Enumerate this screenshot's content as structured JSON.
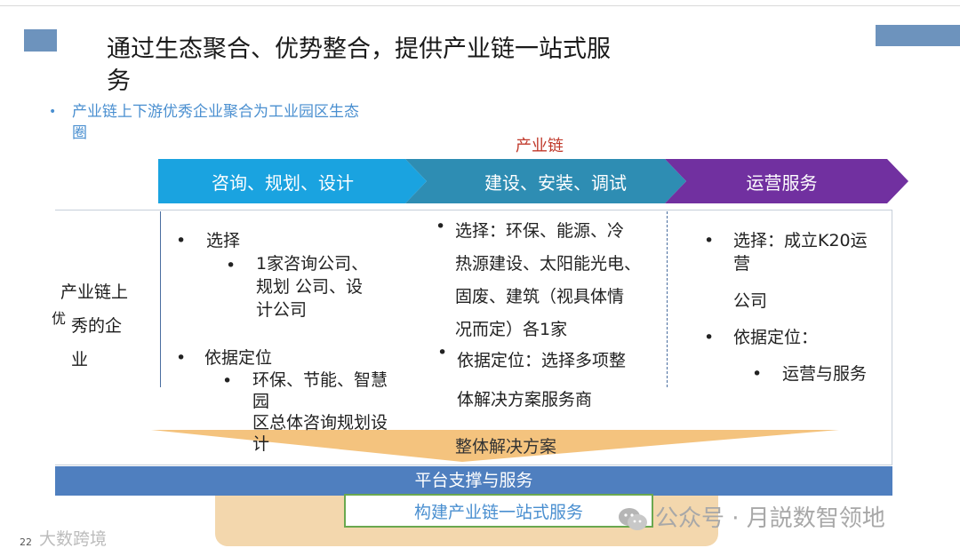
{
  "title": "通过生态聚合、优势整合，提供产业链一站式服务",
  "title_line1": "通过生态聚合、优势整合，提供产业链一站式服",
  "title_line2": "务",
  "bullet_dot": "•",
  "main_bullet_line1": "产业链上下游优秀企业聚合为工业园区生态",
  "main_bullet_line2": "圈",
  "chain_label": "产业链",
  "stages": [
    {
      "label": "咨询、规划、设计",
      "color": "#1aa3e0"
    },
    {
      "label": "建设、安装、调试",
      "color": "#2e8db3"
    },
    {
      "label": "运营服务",
      "color": "#7130a0"
    }
  ],
  "left_label": {
    "line1": "产业链上",
    "line2_small": "优",
    "line2": "秀的企",
    "line3": "业"
  },
  "col1": {
    "b1": "选择",
    "b1_sub": [
      "1家咨询公司、",
      "规划 公司、设",
      "计公司"
    ],
    "b2": "依据定位",
    "b2_sub": [
      "环保、节能、智慧",
      "园",
      "区总体咨询规划设",
      "计"
    ]
  },
  "col2": {
    "b1_lines": [
      "选择：环保、能源、冷",
      "热源建设、太阳能光电、",
      "固废、建筑（视具体情",
      "况而定）各1家"
    ],
    "b2_lines": [
      "依据定位：选择多项整",
      "体解决方案服务商"
    ]
  },
  "col3": {
    "b1_lines": [
      "选择：成立K20运",
      "营",
      "公司"
    ],
    "b2": "依据定位：",
    "b2_sub": "运营与服务"
  },
  "funnel_label": "整体解决方案",
  "funnel_color": "#f2b867",
  "platform_label": "平台支撑与服务",
  "bottom_label": "构建产业链一站式服务",
  "page_number": "22",
  "watermark_left": "大数跨境",
  "watermark_right": "公众号 · 月説数智领地"
}
